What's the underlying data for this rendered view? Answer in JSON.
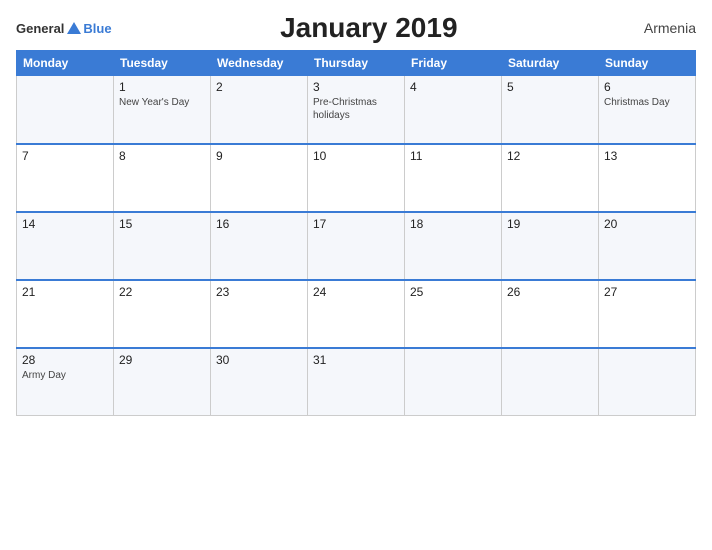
{
  "header": {
    "logo_general": "General",
    "logo_blue": "Blue",
    "title": "January 2019",
    "country": "Armenia"
  },
  "weekdays": [
    "Monday",
    "Tuesday",
    "Wednesday",
    "Thursday",
    "Friday",
    "Saturday",
    "Sunday"
  ],
  "weeks": [
    [
      {
        "day": "",
        "events": []
      },
      {
        "day": "1",
        "events": [
          "New Year's Day"
        ]
      },
      {
        "day": "2",
        "events": []
      },
      {
        "day": "3",
        "events": [
          "Pre-Christmas",
          "holidays"
        ]
      },
      {
        "day": "4",
        "events": []
      },
      {
        "day": "5",
        "events": []
      },
      {
        "day": "6",
        "events": [
          "Christmas Day"
        ]
      }
    ],
    [
      {
        "day": "7",
        "events": []
      },
      {
        "day": "8",
        "events": []
      },
      {
        "day": "9",
        "events": []
      },
      {
        "day": "10",
        "events": []
      },
      {
        "day": "11",
        "events": []
      },
      {
        "day": "12",
        "events": []
      },
      {
        "day": "13",
        "events": []
      }
    ],
    [
      {
        "day": "14",
        "events": []
      },
      {
        "day": "15",
        "events": []
      },
      {
        "day": "16",
        "events": []
      },
      {
        "day": "17",
        "events": []
      },
      {
        "day": "18",
        "events": []
      },
      {
        "day": "19",
        "events": []
      },
      {
        "day": "20",
        "events": []
      }
    ],
    [
      {
        "day": "21",
        "events": []
      },
      {
        "day": "22",
        "events": []
      },
      {
        "day": "23",
        "events": []
      },
      {
        "day": "24",
        "events": []
      },
      {
        "day": "25",
        "events": []
      },
      {
        "day": "26",
        "events": []
      },
      {
        "day": "27",
        "events": []
      }
    ],
    [
      {
        "day": "28",
        "events": [
          "Army Day"
        ]
      },
      {
        "day": "29",
        "events": []
      },
      {
        "day": "30",
        "events": []
      },
      {
        "day": "31",
        "events": []
      },
      {
        "day": "",
        "events": []
      },
      {
        "day": "",
        "events": []
      },
      {
        "day": "",
        "events": []
      }
    ]
  ]
}
